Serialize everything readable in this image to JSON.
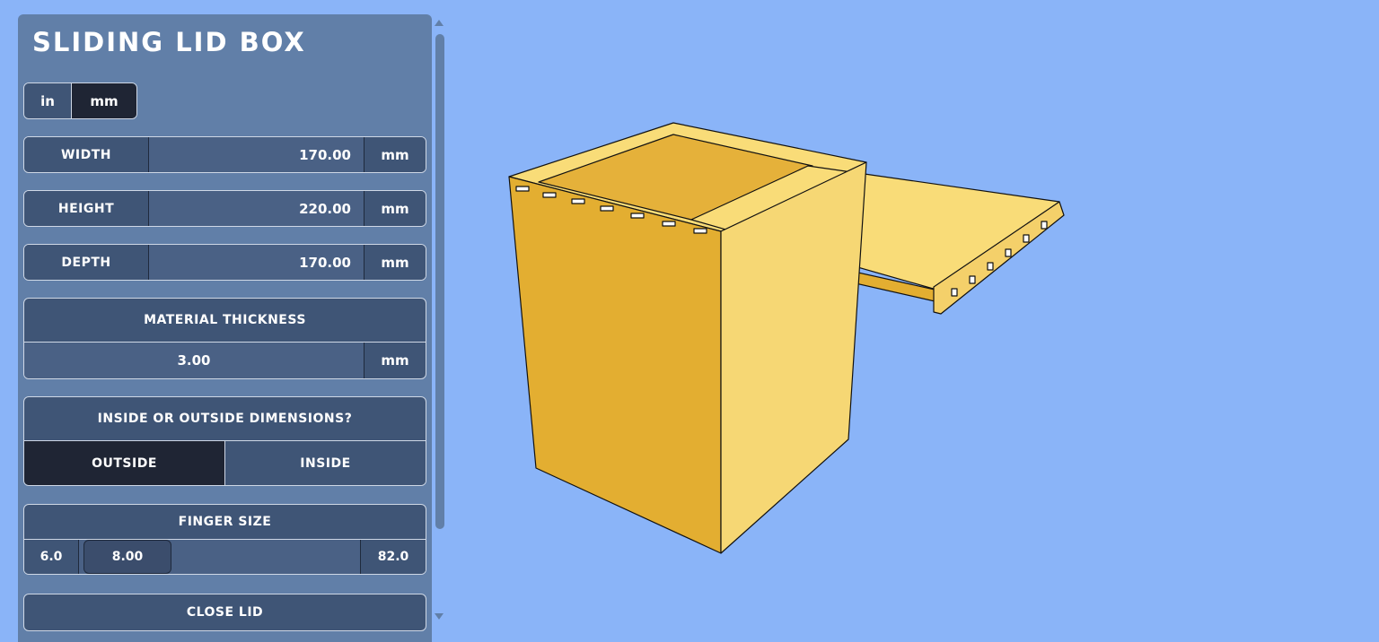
{
  "app": {
    "title": "SLIDING LID BOX"
  },
  "units": {
    "in_label": "in",
    "mm_label": "mm",
    "selected": "mm"
  },
  "dimensions": [
    {
      "label": "WIDTH",
      "value": "170.00",
      "unit": "mm"
    },
    {
      "label": "Height",
      "value": "220.00",
      "unit": "mm"
    },
    {
      "label": "Depth",
      "value": "170.00",
      "unit": "mm"
    }
  ],
  "material": {
    "label": "Material thickness",
    "value": "3.00",
    "unit": "mm"
  },
  "inside_outside": {
    "label": "Inside or outside dimensions?",
    "outside_label": "outside",
    "inside_label": "inside",
    "selected": "outside"
  },
  "finger": {
    "label": "Finger size",
    "min": "6.0",
    "value": "8.00",
    "max": "82.0"
  },
  "lid_button": {
    "label": "CLOSE LID"
  },
  "colors": {
    "background": "#8ab4f8",
    "panel": "#617fa8",
    "control": "#3f5576",
    "selected": "#1f2534",
    "wood_light": "#f9dc78",
    "wood_dark": "#e3ae31"
  }
}
